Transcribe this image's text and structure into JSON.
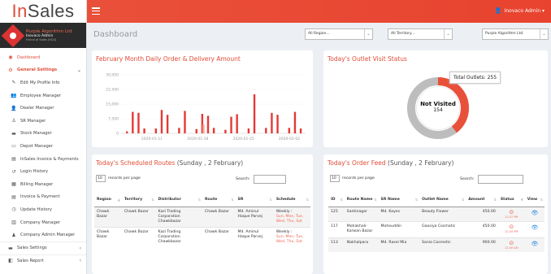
{
  "logo": {
    "part1": "In",
    "part2": "Sales"
  },
  "profile": {
    "company": "Purple Algorithm Ltd",
    "name": "Inovaco Admin",
    "status": "Friend of Sales (HCD)"
  },
  "sidebar": {
    "items": [
      {
        "label": "Dashboard",
        "icon": "dashboard-icon",
        "glyph": "◉",
        "kind": "top"
      },
      {
        "label": "General Settings",
        "icon": "cogs-icon",
        "glyph": "⚙",
        "kind": "sec",
        "arrow": "⌄"
      },
      {
        "label": "Edit My Profile Info",
        "icon": "edit-icon",
        "glyph": "✎",
        "kind": "sub"
      },
      {
        "label": "Employee Manager",
        "icon": "users-icon",
        "glyph": "👥",
        "kind": "sub"
      },
      {
        "label": "Dealer Manager",
        "icon": "user-icon",
        "glyph": "👤",
        "kind": "sub"
      },
      {
        "label": "SR Manager",
        "icon": "user-outline-icon",
        "glyph": "♙",
        "kind": "sub"
      },
      {
        "label": "Stock Manager",
        "icon": "truck-icon",
        "glyph": "▬",
        "kind": "sub"
      },
      {
        "label": "Depot Manager",
        "icon": "depot-icon",
        "glyph": "▭",
        "kind": "sub"
      },
      {
        "label": "InSales Invoice & Payments",
        "icon": "invoice-icon",
        "glyph": "▤",
        "kind": "sub"
      },
      {
        "label": "Login History",
        "icon": "history-icon",
        "glyph": "↺",
        "kind": "sub"
      },
      {
        "label": "Billing Manager",
        "icon": "billing-icon",
        "glyph": "▦",
        "kind": "sub"
      },
      {
        "label": "Invoice & Payment",
        "icon": "invoice-payment-icon",
        "glyph": "▤",
        "kind": "sub"
      },
      {
        "label": "Update History",
        "icon": "update-history-icon",
        "glyph": "◷",
        "kind": "sub"
      },
      {
        "label": "Company Manager",
        "icon": "bank-icon",
        "glyph": "▥",
        "kind": "sub"
      },
      {
        "label": "Company Admin Manager",
        "icon": "admin-icon",
        "glyph": "♟",
        "kind": "sub"
      },
      {
        "label": "Sales Settings",
        "icon": "sales-settings-icon",
        "glyph": "▬",
        "kind": "bottom",
        "arrow": "‹"
      },
      {
        "label": "Sales Report",
        "icon": "report-icon",
        "glyph": "◧",
        "kind": "bottom",
        "arrow": "‹"
      }
    ]
  },
  "topbar": {
    "user": "Inovaco Admin"
  },
  "page": {
    "title": "Dashboard"
  },
  "filters": {
    "region": "All Region...",
    "territory": "All Territory...",
    "company": "Purple Algorithm Ltd"
  },
  "daily_chart": {
    "title": "February Month Daily Order & Delivery Amount"
  },
  "chart_data": {
    "type": "bar",
    "yticks": [
      "30,000",
      "22,500",
      "15,000",
      "7,500",
      "0"
    ],
    "ylim": [
      0,
      30000
    ],
    "xticks": [
      "2020-01-11",
      "2020-01-18",
      "2020-01-25",
      "2020-02-02"
    ],
    "series": [
      {
        "color": "#e53935",
        "values": [
          1000,
          11000,
          10500,
          2500,
          0,
          2500,
          12000,
          9500,
          0,
          2800,
          11500,
          0,
          2200,
          10000,
          9000,
          2800,
          0,
          1800,
          8500,
          9800,
          0,
          2500,
          20000,
          0,
          2800,
          10500,
          9500,
          0,
          2800,
          11000,
          2500
        ]
      },
      {
        "color": "#f4a89a",
        "values": [
          0,
          0,
          0,
          0,
          0,
          0,
          0,
          0,
          0,
          0,
          0,
          0,
          0,
          4500,
          0,
          0,
          0,
          0,
          0,
          0,
          0,
          0,
          0,
          0,
          0,
          0,
          0,
          0,
          0,
          0,
          0
        ]
      }
    ]
  },
  "outlet": {
    "title": "Today's Outlet Visit Status",
    "total": "Total Outlets: 255",
    "label": "Not Visited",
    "value": "154",
    "visited_fraction": 0.396,
    "colors": {
      "not_visited": "#bdbdbd",
      "visited": "#e9503a"
    }
  },
  "routes": {
    "title": "Today's Scheduled Routes",
    "subtitle": "(Sunday , 2 February)",
    "length_value": "10",
    "length_suffix": "records per page",
    "search": "Search:",
    "columns": [
      "Region",
      "Territory",
      "Distributor",
      "Route",
      "SR",
      "Schedule"
    ],
    "rows": [
      [
        "Chawk Bazar",
        "Chawk Bazar",
        "Kazi Trading Corporation Chawkbazar",
        "Chawk Bazar",
        "Md. Aminul Haque Parvej",
        "Weekly :",
        "Sun, Mon, Tue, Wed, Thu, Sat"
      ],
      [
        "Chawk Bazar",
        "Chawk Bazar",
        "Kazi Trading Corporation Chawkbazar",
        "Chawk Bazar",
        "Md. Aminul Haque Parvej",
        "Weekly :",
        "Sun, Mon, Tue, Wed, Thu, Sat"
      ]
    ]
  },
  "feed": {
    "title": "Today's Order Feed",
    "subtitle": "(Sunday , 2 February)",
    "length_value": "10",
    "length_suffix": "records per page",
    "search": "Search:",
    "columns": [
      "ID",
      "Route Name",
      "SR Name",
      "Outlet Name",
      "Amount",
      "Status",
      "View"
    ],
    "rows": [
      [
        "125",
        "Santinagar",
        "Md. Kayes",
        "Beauty Flower",
        "450.00",
        "12:37 PM"
      ],
      [
        "117",
        "Mohakhali-Karwan Bazar",
        "Moheuddin",
        "Gaosiya Cosmatic",
        "450.00",
        "12:20 PM"
      ],
      [
        "113",
        "Nakhalpara",
        "Md. Rasel Mia",
        "Sania Cosmetic",
        "900.00",
        "11:49 AM"
      ]
    ]
  }
}
